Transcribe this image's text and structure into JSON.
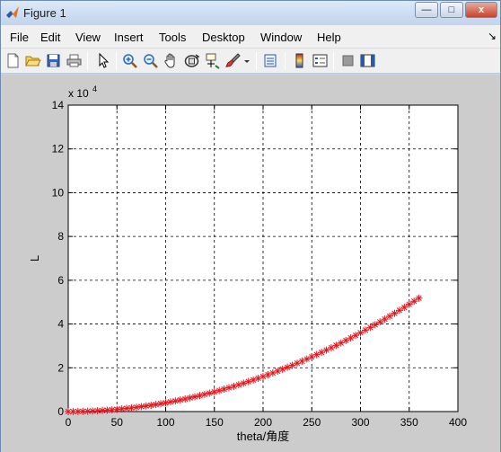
{
  "window": {
    "title": "Figure 1",
    "buttons": {
      "minimize": "—",
      "maximize": "□",
      "close": "x"
    }
  },
  "menubar": {
    "items": [
      "File",
      "Edit",
      "View",
      "Insert",
      "Tools",
      "Desktop",
      "Window",
      "Help"
    ],
    "overflow": "↘"
  },
  "toolbar": {
    "icons": [
      "new-figure-icon",
      "open-file-icon",
      "save-icon",
      "print-icon",
      "edit-plot-arrow-icon",
      "zoom-in-icon",
      "zoom-out-icon",
      "pan-hand-icon",
      "rotate-3d-icon",
      "data-cursor-icon",
      "brush-icon",
      "link-plot-icon",
      "colorbar-icon",
      "legend-icon",
      "hide-plot-tools-icon",
      "show-plot-tools-icon"
    ]
  },
  "colors": {
    "marker": "#e8141c",
    "grid": "#000000",
    "figure_bg": "#cccccc",
    "axes_bg": "#ffffff"
  },
  "chart_data": {
    "type": "scatter",
    "marker": "*",
    "xlabel": "theta/角度",
    "ylabel": "L",
    "exponent_label": "x 10",
    "exponent_power": "4",
    "xlim": [
      0,
      400
    ],
    "ylim": [
      0,
      140000
    ],
    "xticks": [
      0,
      50,
      100,
      150,
      200,
      250,
      300,
      350,
      400
    ],
    "yticks": [
      0,
      20000,
      40000,
      60000,
      80000,
      100000,
      120000,
      140000
    ],
    "ytick_labels": [
      "0",
      "2",
      "4",
      "6",
      "8",
      "10",
      "12",
      "14"
    ],
    "grid": true,
    "series": [
      {
        "x": [
          0,
          5,
          10,
          15,
          20,
          25,
          30,
          35,
          40,
          45,
          50,
          55,
          60,
          65,
          70,
          75,
          80,
          85,
          90,
          95,
          100,
          105,
          110,
          115,
          120,
          125,
          130,
          135,
          140,
          145,
          150,
          155,
          160,
          165,
          170,
          175,
          180,
          185,
          190,
          195,
          200,
          205,
          210,
          215,
          220,
          225,
          230,
          235,
          240,
          245,
          250,
          255,
          260,
          265,
          270,
          275,
          280,
          285,
          290,
          295,
          300,
          305,
          310,
          315,
          320,
          325,
          330,
          335,
          340,
          345,
          350,
          355,
          360
        ],
        "y": [
          0,
          10,
          40,
          90,
          160,
          250,
          360,
          490,
          640,
          810,
          1000,
          1210,
          1440,
          1690,
          1960,
          2250,
          2560,
          2890,
          3240,
          3610,
          4000,
          4410,
          4840,
          5290,
          5760,
          6250,
          6760,
          7290,
          7840,
          8410,
          9000,
          9610,
          10240,
          10890,
          11560,
          12250,
          12960,
          13690,
          14440,
          15210,
          16000,
          16810,
          17640,
          18490,
          19360,
          20250,
          21160,
          22090,
          23040,
          24010,
          25000,
          26010,
          27040,
          28090,
          29160,
          30250,
          31360,
          32490,
          33640,
          34810,
          36000,
          37210,
          38440,
          39690,
          40960,
          42250,
          43560,
          44890,
          46240,
          47610,
          49000,
          50410,
          51840
        ]
      }
    ]
  }
}
